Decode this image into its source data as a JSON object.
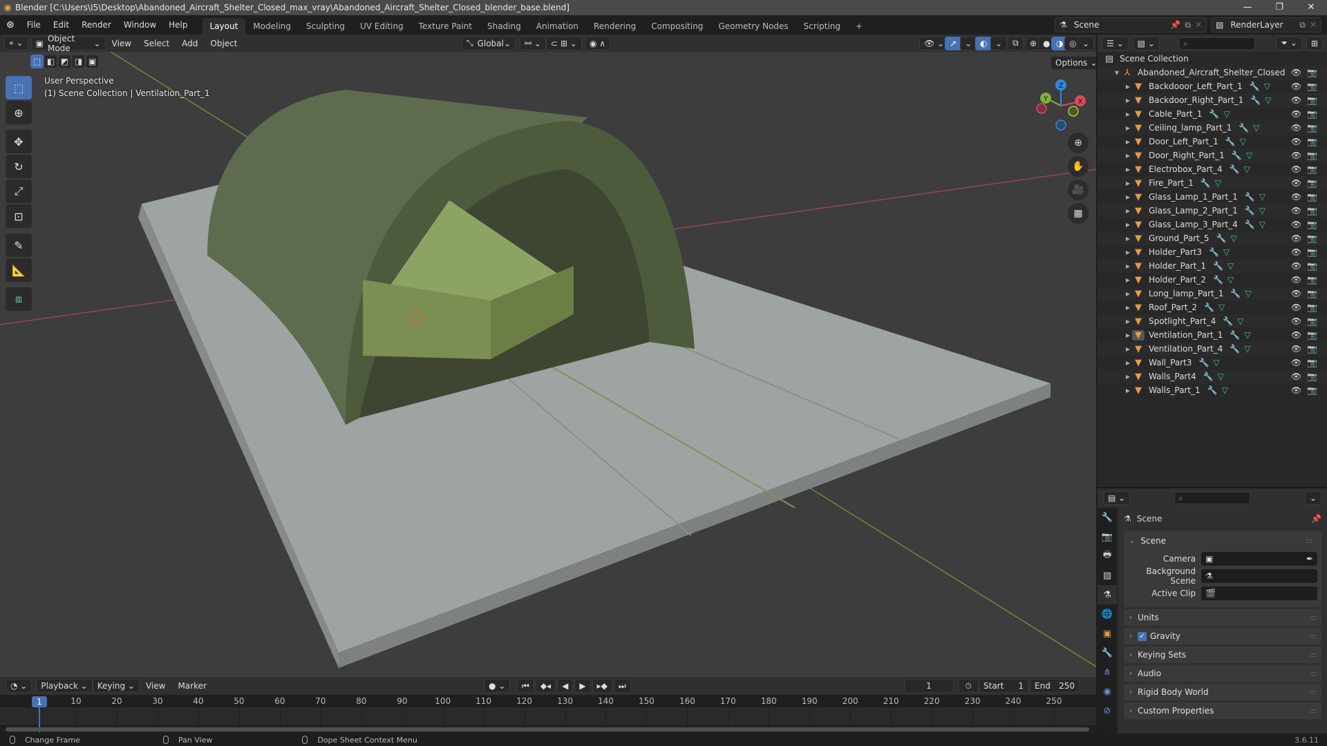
{
  "titlebar": {
    "title": "Blender [C:\\Users\\I5\\Desktop\\Abandoned_Aircraft_Shelter_Closed_max_vray\\Abandoned_Aircraft_Shelter_Closed_blender_base.blend]",
    "minimize": "—",
    "maximize": "❐",
    "close": "✕"
  },
  "menubar": {
    "menus": [
      "File",
      "Edit",
      "Render",
      "Window",
      "Help"
    ],
    "workspaces": [
      "Layout",
      "Modeling",
      "Sculpting",
      "UV Editing",
      "Texture Paint",
      "Shading",
      "Animation",
      "Rendering",
      "Compositing",
      "Geometry Nodes",
      "Scripting"
    ],
    "active_workspace": "Layout",
    "add_workspace": "+",
    "scene_name": "Scene",
    "view_layer": "RenderLayer"
  },
  "viewport": {
    "mode": "Object Mode",
    "menus": [
      "View",
      "Select",
      "Add",
      "Object"
    ],
    "orientation": "Global",
    "options_label": "Options",
    "overlay_line1": "User Perspective",
    "overlay_line2": "(1) Scene Collection | Ventilation_Part_1",
    "gizmo": {
      "z": "Z",
      "y": "Y",
      "x": "X"
    },
    "axis_colors": {
      "x": "#e2485d",
      "y": "#7fb33a",
      "z": "#2d8ae0"
    }
  },
  "outliner": {
    "root": "Scene Collection",
    "collection": "Abandoned_Aircraft_Shelter_Closed",
    "selected": "Ventilation_Part_1",
    "items": [
      "Backdooor_Left_Part_1",
      "Backdoor_Right_Part_1",
      "Cable_Part_1",
      "Ceiling_lamp_Part_1",
      "Door_Left_Part_1",
      "Door_Right_Part_1",
      "Electrobox_Part_4",
      "Fire_Part_1",
      "Glass_Lamp_1_Part_1",
      "Glass_Lamp_2_Part_1",
      "Glass_Lamp_3_Part_4",
      "Ground_Part_5",
      "Holder_Part3",
      "Holder_Part_1",
      "Holder_Part_2",
      "Long_lamp_Part_1",
      "Roof_Part_2",
      "Spotlight_Part_4",
      "Ventilation_Part_1",
      "Ventilation_Part_4",
      "Wall_Part3",
      "Walls_Part4",
      "Walls_Part_1"
    ]
  },
  "properties": {
    "context_title": "Scene",
    "section": "Scene",
    "fields": [
      {
        "label": "Camera",
        "value": ""
      },
      {
        "label": "Background Scene",
        "value": ""
      },
      {
        "label": "Active Clip",
        "value": ""
      }
    ],
    "panels": [
      "Units",
      "Gravity",
      "Keying Sets",
      "Audio",
      "Rigid Body World",
      "Custom Properties"
    ],
    "gravity_enabled": true
  },
  "timeline": {
    "menus": [
      "Playback",
      "Keying",
      "View",
      "Marker"
    ],
    "current_frame": "1",
    "start_label": "Start",
    "start": "1",
    "end_label": "End",
    "end": "250",
    "ticks": [
      "10",
      "20",
      "30",
      "40",
      "50",
      "60",
      "70",
      "80",
      "90",
      "100",
      "110",
      "120",
      "130",
      "140",
      "150",
      "160",
      "170",
      "180",
      "190",
      "200",
      "210",
      "220",
      "230",
      "240",
      "250"
    ]
  },
  "statusbar": {
    "hints": [
      "Change Frame",
      "Pan View",
      "Dope Sheet Context Menu"
    ],
    "version": "3.6.11"
  }
}
